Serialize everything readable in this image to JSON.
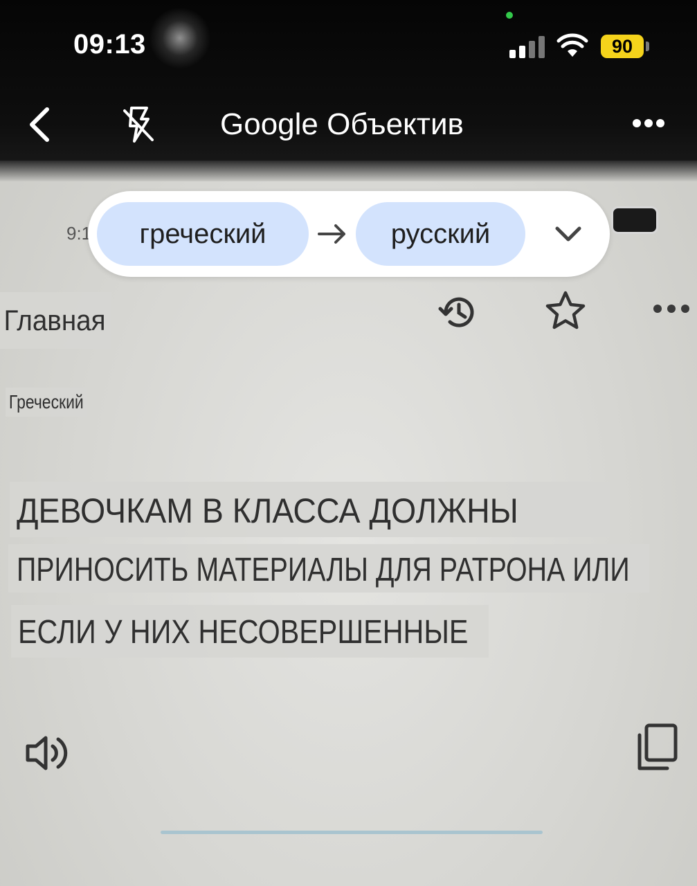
{
  "status_bar": {
    "time": "09:13",
    "battery": "90",
    "colors": {
      "battery": "#f5d31b",
      "privacy_dot": "#33c94b"
    }
  },
  "header": {
    "title": "Google Объектив",
    "back_icon": "chevron-left-icon",
    "flash_icon": "flash-off-icon",
    "more_icon": "more-horizontal-icon"
  },
  "language_selector": {
    "source": "греческий",
    "target": "русский",
    "swap_icon": "arrow-right-icon",
    "dropdown_icon": "chevron-down-icon",
    "colors": {
      "chip": "#d3e3fd",
      "bar": "#ffffff"
    }
  },
  "scene": {
    "time_partial": "9:1",
    "home_label": "Главная",
    "language_label": "Греческий",
    "translated_lines": [
      "ДЕВОЧКАМ В КЛАССА ДОЛЖНЫ",
      "ПРИНОСИТЬ МАТЕРИАЛЫ ДЛЯ РАТРОНА ИЛИ",
      "ЕСЛИ У НИХ НЕСОВЕРШЕННЫЕ"
    ],
    "icons": [
      "history-icon",
      "star-icon",
      "more-horizontal-icon",
      "speaker-icon",
      "copy-icon"
    ]
  }
}
